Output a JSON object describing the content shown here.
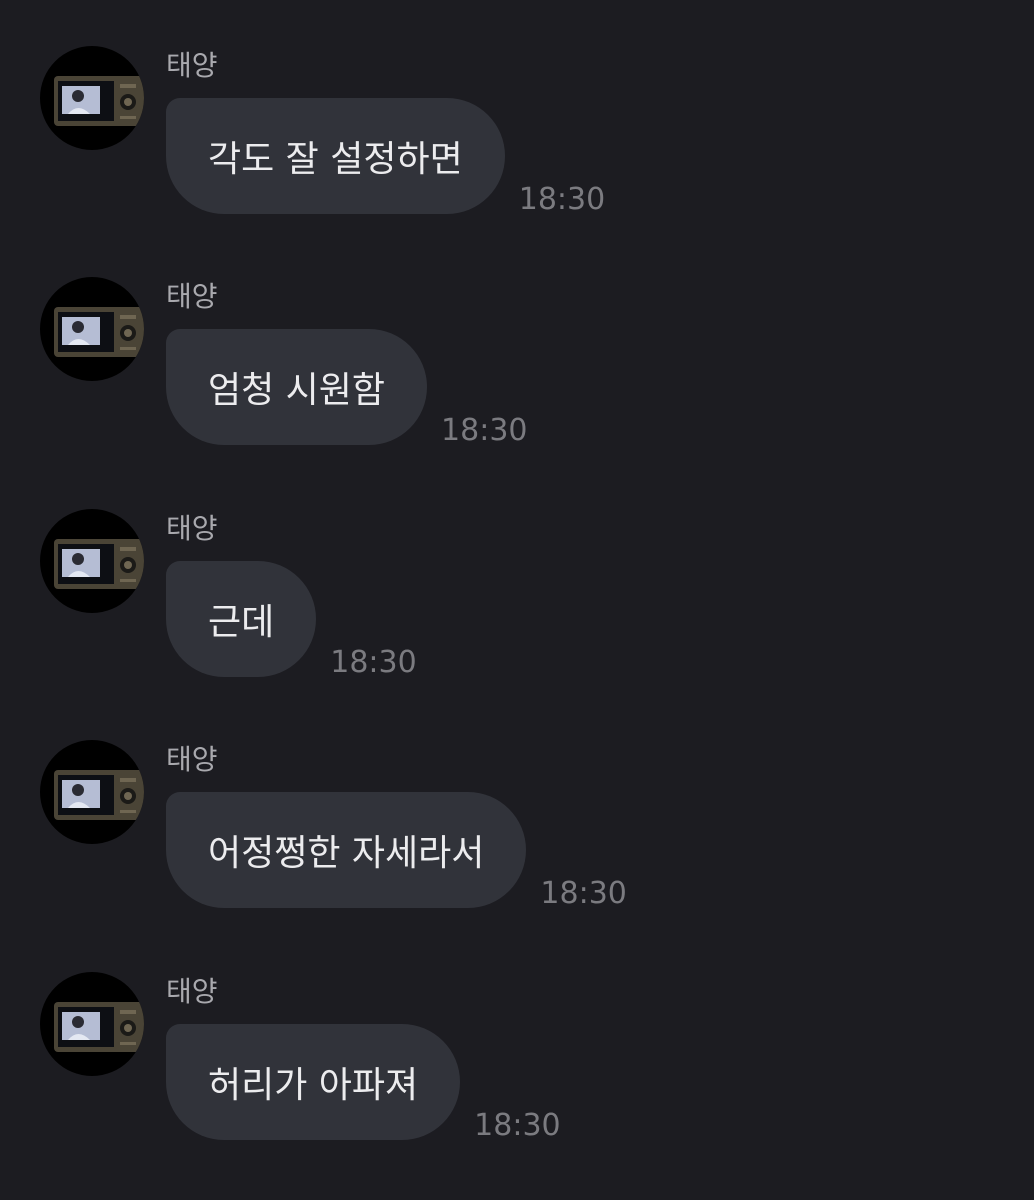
{
  "messages": [
    {
      "sender": "태양",
      "text": "각도 잘 설정하면",
      "time": "18:30"
    },
    {
      "sender": "태양",
      "text": "엄청 시원함",
      "time": "18:30"
    },
    {
      "sender": "태양",
      "text": "근데",
      "time": "18:30"
    },
    {
      "sender": "태양",
      "text": "어정쩡한 자세라서",
      "time": "18:30"
    },
    {
      "sender": "태양",
      "text": "허리가 아파져",
      "time": "18:30"
    }
  ],
  "avatar_icon": "camera-photo-avatar",
  "colors": {
    "background": "#1c1c21",
    "bubble": "#31333a",
    "text": "#ececee",
    "sender": "#a9a9ae",
    "time": "#7b7b80"
  }
}
